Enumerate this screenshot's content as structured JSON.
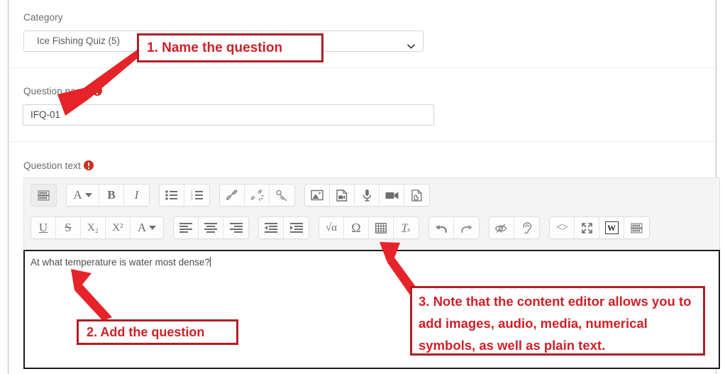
{
  "form": {
    "category": {
      "label": "Category",
      "value": "Ice Fishing Quiz (5)",
      "chevron_icon": "chevron-down-icon"
    },
    "question_name": {
      "label": "Question name",
      "value": "IFQ-01",
      "required_icon": "required-exclamation-icon"
    },
    "question_text": {
      "label": "Question text",
      "required_icon": "required-exclamation-icon",
      "content": "At what temperature is water most dense?"
    }
  },
  "editor": {
    "toolbar_row_1": [
      {
        "name": "expand-toolbars-button",
        "icon": "toolbar-toggle-icon",
        "label": "",
        "active": true
      },
      {
        "name": "font-style-button",
        "icon": "font-letter-a-icon",
        "label": "A",
        "dropdown": true
      },
      {
        "name": "bold-button",
        "icon": "bold-icon",
        "label": "B"
      },
      {
        "name": "italic-button",
        "icon": "italic-icon",
        "label": "I"
      },
      {
        "name": "bullet-list-button",
        "icon": "bullet-list-icon",
        "label": ""
      },
      {
        "name": "numbered-list-button",
        "icon": "numbered-list-icon",
        "label": ""
      },
      {
        "name": "insert-link-button",
        "icon": "link-icon",
        "label": ""
      },
      {
        "name": "unlink-button",
        "icon": "broken-link-icon",
        "label": ""
      },
      {
        "name": "anchor-button",
        "icon": "anchor-link-icon",
        "label": ""
      },
      {
        "name": "insert-image-button",
        "icon": "image-icon",
        "label": ""
      },
      {
        "name": "insert-media-button",
        "icon": "media-file-icon",
        "label": ""
      },
      {
        "name": "record-audio-button",
        "icon": "microphone-icon",
        "label": ""
      },
      {
        "name": "record-video-button",
        "icon": "video-camera-icon",
        "label": ""
      },
      {
        "name": "manage-files-button",
        "icon": "file-drag-icon",
        "label": ""
      }
    ],
    "toolbar_row_2": [
      {
        "name": "underline-button",
        "icon": "underline-icon",
        "label": "U"
      },
      {
        "name": "strikethrough-button",
        "icon": "strikethrough-icon",
        "label": "S"
      },
      {
        "name": "subscript-button",
        "icon": "subscript-icon",
        "label": "X₂"
      },
      {
        "name": "superscript-button",
        "icon": "superscript-icon",
        "label": "X²"
      },
      {
        "name": "text-color-button",
        "icon": "font-color-a-icon",
        "label": "A",
        "dropdown": true
      },
      {
        "name": "align-left-button",
        "icon": "align-left-icon",
        "label": ""
      },
      {
        "name": "align-center-button",
        "icon": "align-center-icon",
        "label": ""
      },
      {
        "name": "align-right-button",
        "icon": "align-right-icon",
        "label": ""
      },
      {
        "name": "outdent-button",
        "icon": "outdent-icon",
        "label": ""
      },
      {
        "name": "indent-button",
        "icon": "indent-icon",
        "label": ""
      },
      {
        "name": "equation-editor-button",
        "icon": "square-root-icon",
        "label": "√α"
      },
      {
        "name": "special-character-button",
        "icon": "omega-icon",
        "label": "Ω"
      },
      {
        "name": "insert-table-button",
        "icon": "table-icon",
        "label": ""
      },
      {
        "name": "clear-formatting-button",
        "icon": "clear-formatting-tx-icon",
        "label": "Tₓ"
      },
      {
        "name": "undo-button",
        "icon": "undo-arrow-icon",
        "label": ""
      },
      {
        "name": "redo-button",
        "icon": "redo-arrow-icon",
        "label": ""
      },
      {
        "name": "accessibility-checker-button",
        "icon": "eye-slash-icon",
        "label": ""
      },
      {
        "name": "screenreader-helper-button",
        "icon": "ear-icon",
        "label": ""
      },
      {
        "name": "html-source-button",
        "icon": "code-brackets-icon",
        "label": "<>"
      },
      {
        "name": "fullscreen-button",
        "icon": "expand-arrows-icon",
        "label": ""
      },
      {
        "name": "paste-from-word-button",
        "icon": "word-w-icon",
        "label": "W"
      },
      {
        "name": "collapse-toolbars-button",
        "icon": "toolbar-toggle-icon",
        "label": ""
      }
    ]
  },
  "annotations": {
    "callout_1": "1. Name the question",
    "callout_2": "2. Add the question",
    "callout_3": "3. Note that the content editor allows you to add images, audio, media, numerical symbols, as well as plain text.",
    "arrow_color": "#e52329",
    "box_border_color": "#b01f24",
    "text_color": "#d01f26"
  }
}
